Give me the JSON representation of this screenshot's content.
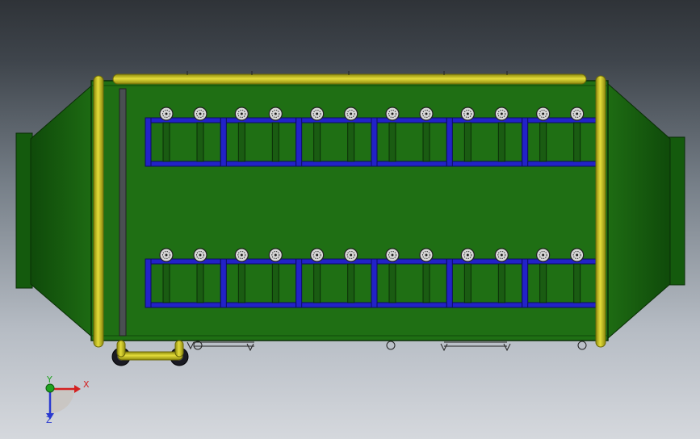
{
  "triad": {
    "x_label": "X",
    "y_label": "Y",
    "z_label": "Z"
  },
  "colors": {
    "body": "#1f6f14",
    "body_dark": "#114a0a",
    "frame": "#2222c8",
    "pipe": "#c9c21a",
    "axis_x": "#d42020",
    "axis_y": "#1fa21f",
    "axis_z": "#2a3ad0"
  },
  "diagram": {
    "frame_rows": 2,
    "frame_modules_per_row": 6,
    "nozzles_per_module": 2
  }
}
